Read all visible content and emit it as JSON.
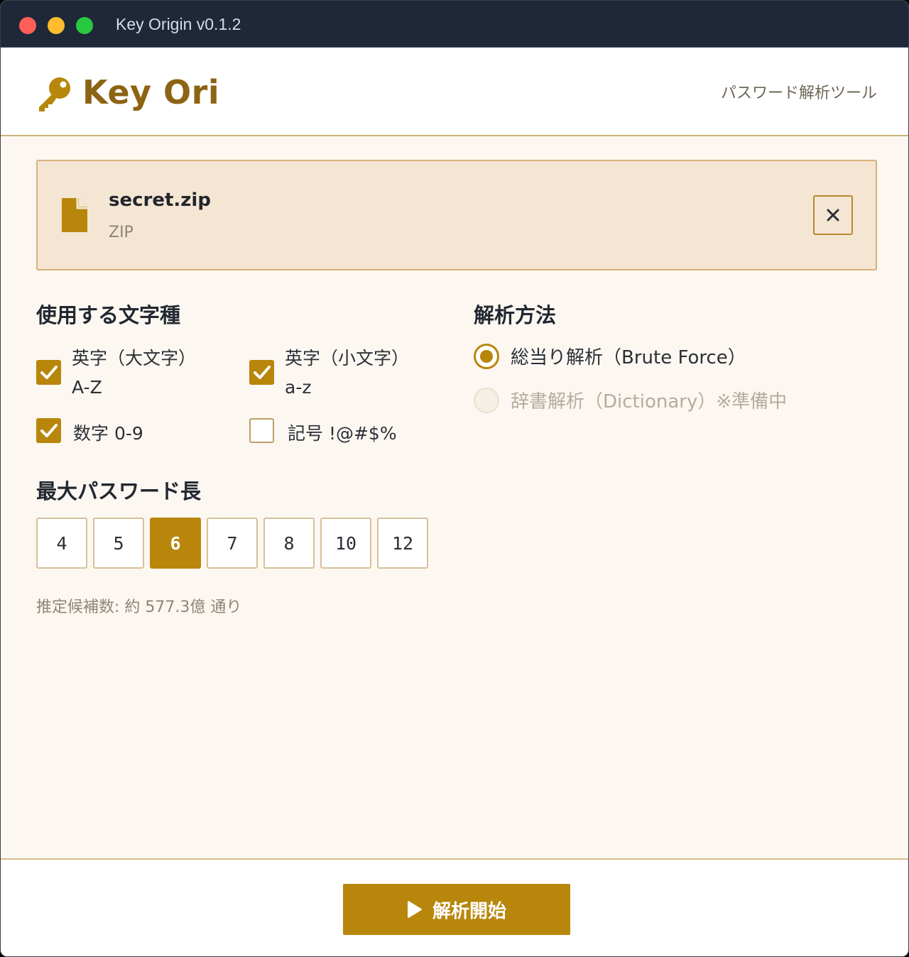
{
  "window": {
    "title": "Key Origin v0.1.2"
  },
  "header": {
    "logo_text": "Key Ori",
    "subtitle": "パスワード解析ツール",
    "logo_icon": "key-icon"
  },
  "file": {
    "name": "secret.zip",
    "type": "ZIP",
    "icon": "file-icon",
    "close_icon": "close-icon"
  },
  "charset": {
    "title": "使用する文字種",
    "options": [
      {
        "label": "英字（大文字）",
        "sub": "A-Z",
        "checked": true
      },
      {
        "label": "英字（小文字）",
        "sub": "a-z",
        "checked": true
      },
      {
        "label": "数字 0-9",
        "checked": true
      },
      {
        "label": "記号 !@#$%",
        "checked": false
      }
    ]
  },
  "method": {
    "title": "解析方法",
    "options": [
      {
        "label": "総当り解析（Brute Force）",
        "selected": true,
        "disabled": false
      },
      {
        "label": "辞書解析（Dictionary）※準備中",
        "selected": false,
        "disabled": true
      }
    ]
  },
  "length": {
    "title": "最大パスワード長",
    "options": [
      "4",
      "5",
      "6",
      "7",
      "8",
      "10",
      "12"
    ],
    "selected": "6"
  },
  "estimate": "推定候補数: 約 577.3億 通り",
  "actions": {
    "start_label": "解析開始",
    "start_icon": "play-icon"
  },
  "colors": {
    "accent": "#b8860b",
    "logo": "#8c6414",
    "titlebar": "#1e2838"
  }
}
